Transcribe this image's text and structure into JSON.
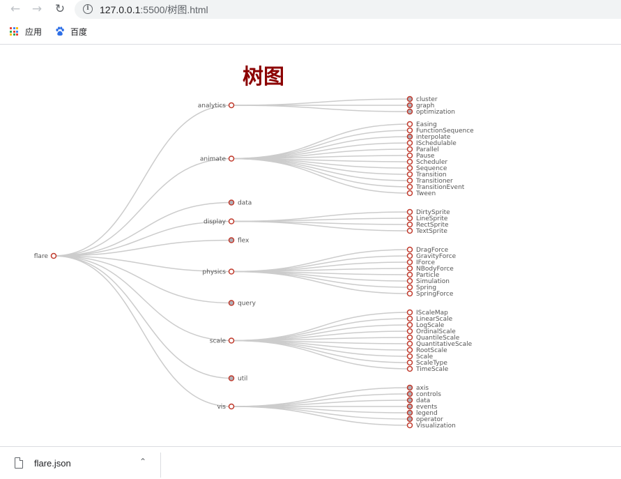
{
  "browser": {
    "url_host": "127.0.0.1",
    "url_rest": ":5500/树图.html",
    "bookmarks": [
      {
        "label": "应用",
        "icon": "apps-grid-icon"
      },
      {
        "label": "百度",
        "icon": "baidu-paw-icon"
      }
    ]
  },
  "page": {
    "title": "树图",
    "link_color": "#cccccc",
    "node_stroke": "#c0392b",
    "collapsed_fill": "#b0b0b8",
    "leaf_fill": "#ffffff"
  },
  "tree": {
    "name": "flare",
    "children": [
      {
        "name": "analytics",
        "children": [
          {
            "name": "cluster",
            "collapsed": true
          },
          {
            "name": "graph",
            "collapsed": true
          },
          {
            "name": "optimization",
            "collapsed": true
          }
        ]
      },
      {
        "name": "animate",
        "children": [
          {
            "name": "Easing"
          },
          {
            "name": "FunctionSequence"
          },
          {
            "name": "interpolate",
            "collapsed": true
          },
          {
            "name": "ISchedulable"
          },
          {
            "name": "Parallel"
          },
          {
            "name": "Pause"
          },
          {
            "name": "Scheduler"
          },
          {
            "name": "Sequence"
          },
          {
            "name": "Transition"
          },
          {
            "name": "Transitioner"
          },
          {
            "name": "TransitionEvent"
          },
          {
            "name": "Tween"
          }
        ]
      },
      {
        "name": "data",
        "collapsed": true
      },
      {
        "name": "display",
        "children": [
          {
            "name": "DirtySprite"
          },
          {
            "name": "LineSprite"
          },
          {
            "name": "RectSprite"
          },
          {
            "name": "TextSprite"
          }
        ]
      },
      {
        "name": "flex",
        "collapsed": true
      },
      {
        "name": "physics",
        "children": [
          {
            "name": "DragForce"
          },
          {
            "name": "GravityForce"
          },
          {
            "name": "IForce"
          },
          {
            "name": "NBodyForce"
          },
          {
            "name": "Particle"
          },
          {
            "name": "Simulation"
          },
          {
            "name": "Spring"
          },
          {
            "name": "SpringForce"
          }
        ]
      },
      {
        "name": "query",
        "collapsed": true
      },
      {
        "name": "scale",
        "children": [
          {
            "name": "IScaleMap"
          },
          {
            "name": "LinearScale"
          },
          {
            "name": "LogScale"
          },
          {
            "name": "OrdinalScale"
          },
          {
            "name": "QuantileScale"
          },
          {
            "name": "QuantitativeScale"
          },
          {
            "name": "RootScale"
          },
          {
            "name": "Scale"
          },
          {
            "name": "ScaleType"
          },
          {
            "name": "TimeScale"
          }
        ]
      },
      {
        "name": "util",
        "collapsed": true
      },
      {
        "name": "vis",
        "children": [
          {
            "name": "axis",
            "collapsed": true
          },
          {
            "name": "controls",
            "collapsed": true
          },
          {
            "name": "data",
            "collapsed": true
          },
          {
            "name": "events",
            "collapsed": true
          },
          {
            "name": "legend",
            "collapsed": true
          },
          {
            "name": "operator",
            "collapsed": true
          },
          {
            "name": "Visualization"
          }
        ]
      }
    ]
  },
  "downloads": {
    "file_name": "flare.json"
  }
}
